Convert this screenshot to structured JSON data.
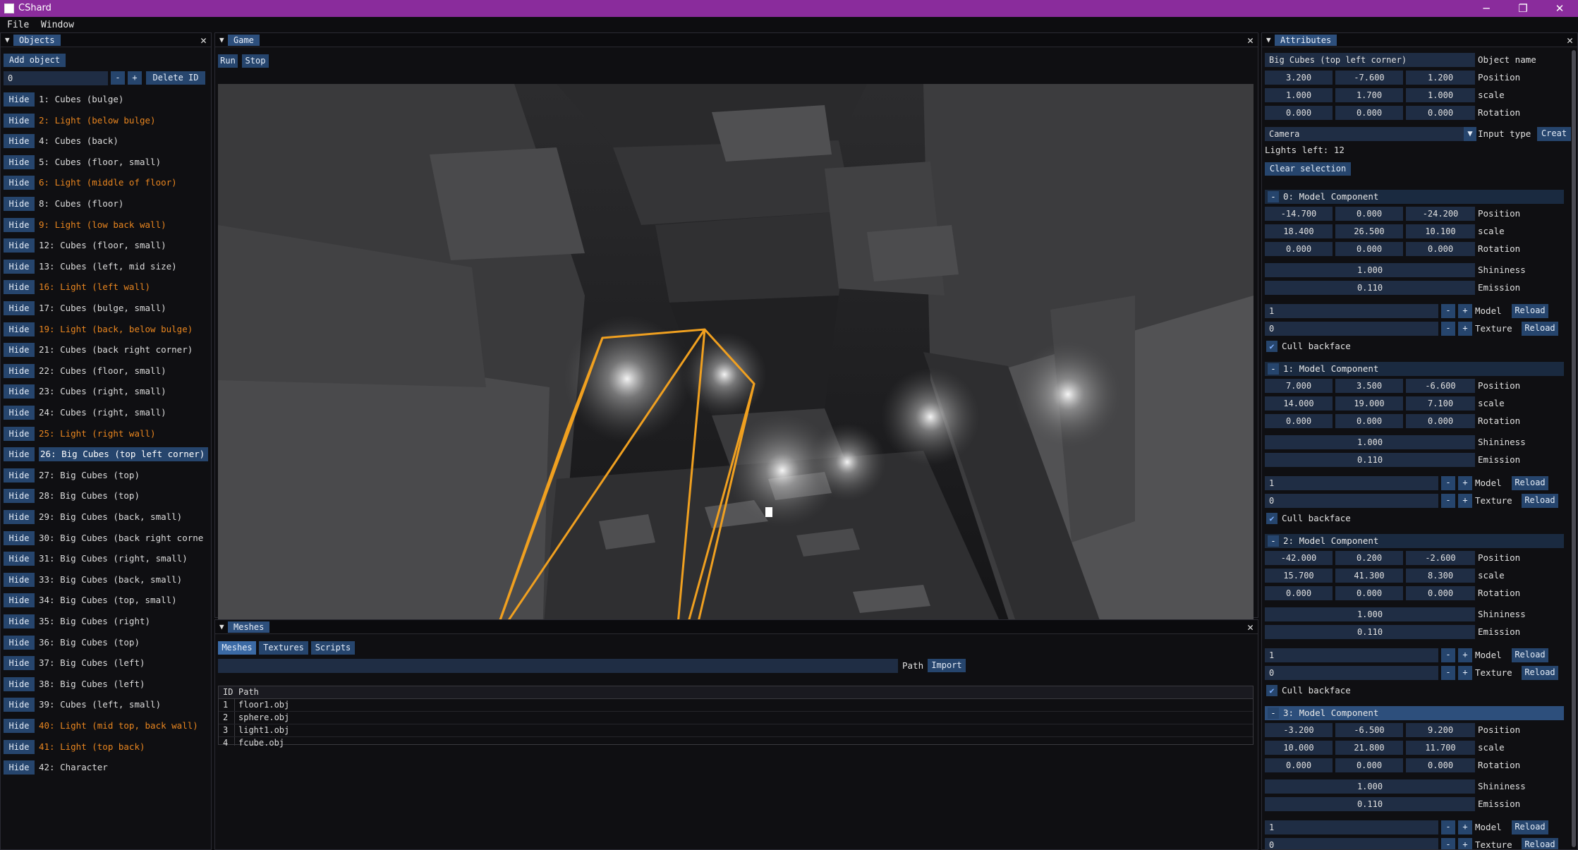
{
  "window": {
    "title": "CShard",
    "controls": [
      "─",
      "❐",
      "✕"
    ]
  },
  "menu": [
    "File",
    "Window"
  ],
  "objects_panel": {
    "tab": "Objects",
    "add_object": "Add object",
    "id_value": "0",
    "minus": "-",
    "plus": "+",
    "delete_id": "Delete ID",
    "hide_label": "Hide",
    "items": [
      {
        "label": "1: Cubes (bulge)",
        "light": false,
        "selected": false
      },
      {
        "label": "2: Light (below bulge)",
        "light": true,
        "selected": false
      },
      {
        "label": "4: Cubes (back)",
        "light": false,
        "selected": false
      },
      {
        "label": "5: Cubes (floor, small)",
        "light": false,
        "selected": false
      },
      {
        "label": "6: Light (middle of floor)",
        "light": true,
        "selected": false
      },
      {
        "label": "8: Cubes (floor)",
        "light": false,
        "selected": false
      },
      {
        "label": "9: Light (low back wall)",
        "light": true,
        "selected": false
      },
      {
        "label": "12: Cubes (floor, small)",
        "light": false,
        "selected": false
      },
      {
        "label": "13: Cubes (left, mid size)",
        "light": false,
        "selected": false
      },
      {
        "label": "16: Light  (left wall)",
        "light": true,
        "selected": false
      },
      {
        "label": "17: Cubes (bulge, small)",
        "light": false,
        "selected": false
      },
      {
        "label": "19: Light (back, below bulge)",
        "light": true,
        "selected": false
      },
      {
        "label": "21: Cubes (back right corner)",
        "light": false,
        "selected": false
      },
      {
        "label": "22: Cubes (floor, small)",
        "light": false,
        "selected": false
      },
      {
        "label": "23: Cubes (right, small)",
        "light": false,
        "selected": false
      },
      {
        "label": "24: Cubes (right, small)",
        "light": false,
        "selected": false
      },
      {
        "label": "25: Light (right wall)",
        "light": true,
        "selected": false
      },
      {
        "label": "26: Big Cubes (top left corner)",
        "light": false,
        "selected": true
      },
      {
        "label": "27: Big Cubes (top)",
        "light": false,
        "selected": false
      },
      {
        "label": "28: Big Cubes (top)",
        "light": false,
        "selected": false
      },
      {
        "label": "29: Big Cubes (back, small)",
        "light": false,
        "selected": false
      },
      {
        "label": "30: Big Cubes (back right corne",
        "light": false,
        "selected": false
      },
      {
        "label": "31: Big Cubes (right, small)",
        "light": false,
        "selected": false
      },
      {
        "label": "33: Big Cubes (back, small)",
        "light": false,
        "selected": false
      },
      {
        "label": "34: Big Cubes (top, small)",
        "light": false,
        "selected": false
      },
      {
        "label": "35: Big Cubes (right)",
        "light": false,
        "selected": false
      },
      {
        "label": "36: Big Cubes (top)",
        "light": false,
        "selected": false
      },
      {
        "label": "37: Big Cubes (left)",
        "light": false,
        "selected": false
      },
      {
        "label": "38: Big Cubes (left)",
        "light": false,
        "selected": false
      },
      {
        "label": "39: Cubes (left, small)",
        "light": false,
        "selected": false
      },
      {
        "label": "40: Light (mid top, back wall)",
        "light": true,
        "selected": false
      },
      {
        "label": "41: Light (top back)",
        "light": true,
        "selected": false
      },
      {
        "label": "42: Character",
        "light": false,
        "selected": false
      }
    ]
  },
  "game_panel": {
    "tab": "Game",
    "run": "Run",
    "stop": "Stop"
  },
  "meshes_panel": {
    "tab": "Meshes",
    "tabs": [
      "Meshes",
      "Textures",
      "Scripts"
    ],
    "path_label": "Path",
    "import": "Import",
    "columns": [
      "ID",
      "Path"
    ],
    "rows": [
      {
        "id": "1",
        "path": "floor1.obj"
      },
      {
        "id": "2",
        "path": "sphere.obj"
      },
      {
        "id": "3",
        "path": "light1.obj"
      },
      {
        "id": "4",
        "path": "fcube.obj"
      }
    ]
  },
  "attributes_panel": {
    "tab": "Attributes",
    "object_name": "Big Cubes (top left corner)",
    "object_name_label": "Object name",
    "position": [
      "3.200",
      "-7.600",
      "1.200"
    ],
    "scale": [
      "1.000",
      "1.700",
      "1.000"
    ],
    "rotation": [
      "0.000",
      "0.000",
      "0.000"
    ],
    "labels": {
      "position": "Position",
      "scale": "scale",
      "rotation": "Rotation",
      "shininess": "Shininess",
      "emission": "Emission",
      "model": "Model",
      "texture": "Texture",
      "reload": "Reload",
      "cull": "Cull backface",
      "minus": "-",
      "plus": "+"
    },
    "input_type_value": "Camera",
    "input_type_label": "Input type",
    "create": "Creat",
    "lights_left": "Lights left: 12",
    "clear_selection": "Clear selection",
    "components": [
      {
        "title": "0: Model Component",
        "position": [
          "-14.700",
          "0.000",
          "-24.200"
        ],
        "scale": [
          "18.400",
          "26.500",
          "10.100"
        ],
        "rotation": [
          "0.000",
          "0.000",
          "0.000"
        ],
        "shininess": "1.000",
        "emission": "0.110",
        "model": "1",
        "texture": "0",
        "active": false
      },
      {
        "title": "1: Model Component",
        "position": [
          "7.000",
          "3.500",
          "-6.600"
        ],
        "scale": [
          "14.000",
          "19.000",
          "7.100"
        ],
        "rotation": [
          "0.000",
          "0.000",
          "0.000"
        ],
        "shininess": "1.000",
        "emission": "0.110",
        "model": "1",
        "texture": "0",
        "active": false
      },
      {
        "title": "2: Model Component",
        "position": [
          "-42.000",
          "0.200",
          "-2.600"
        ],
        "scale": [
          "15.700",
          "41.300",
          "8.300"
        ],
        "rotation": [
          "0.000",
          "0.000",
          "0.000"
        ],
        "shininess": "1.000",
        "emission": "0.110",
        "model": "1",
        "texture": "0",
        "active": false
      },
      {
        "title": "3: Model Component",
        "position": [
          "-3.200",
          "-6.500",
          "9.200"
        ],
        "scale": [
          "10.000",
          "21.800",
          "11.700"
        ],
        "rotation": [
          "0.000",
          "0.000",
          "0.000"
        ],
        "shininess": "1.000",
        "emission": "0.110",
        "model": "1",
        "texture": "0",
        "active": true
      }
    ]
  },
  "colors": {
    "titlebar": "#8a2c9c",
    "button": "#26456d",
    "tab_active": "#2d4f7c",
    "light_text": "#e8851f",
    "selection_outline": "#f0a020"
  }
}
